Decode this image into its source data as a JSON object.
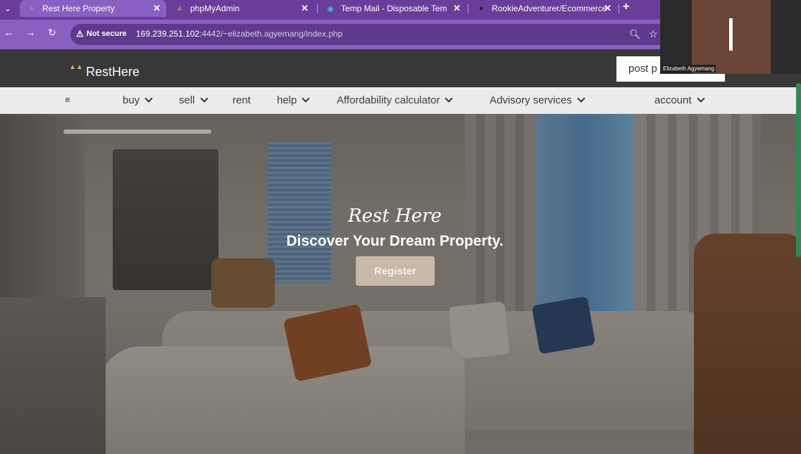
{
  "browser": {
    "tabs": [
      {
        "title": "Rest Here Property",
        "active": true,
        "icon": "globe-icon"
      },
      {
        "title": "phpMyAdmin",
        "active": false,
        "icon": "phpmyadmin-icon"
      },
      {
        "title": "Temp Mail - Disposable Tempo",
        "active": false,
        "icon": "tempmail-icon"
      },
      {
        "title": "RookieAdventurer/Ecommerce",
        "active": false,
        "icon": "github-icon"
      }
    ],
    "security_label": "Not secure",
    "url_host": "169.239.251.102",
    "url_rest": ":4442/~elizabeth.agyemang/index.php"
  },
  "header": {
    "brand": "RestHere",
    "post_button": "post p"
  },
  "nav": {
    "items": [
      {
        "label": "buy",
        "dropdown": true
      },
      {
        "label": "sell",
        "dropdown": true
      },
      {
        "label": "rent",
        "dropdown": false
      },
      {
        "label": "help",
        "dropdown": true
      },
      {
        "label": "Affordability calculator",
        "dropdown": true
      },
      {
        "label": "Advisory services",
        "dropdown": true
      },
      {
        "label": "account",
        "dropdown": true
      }
    ]
  },
  "hero": {
    "script_title": "Rest Here",
    "headline": "Discover Your Dream Property.",
    "register_button": "Register"
  },
  "video": {
    "participant_name": "Elizabeth Agyemang"
  },
  "colors": {
    "tab_strip": "#6a3d9a",
    "toolbar": "#8a5fc2",
    "site_header": "#383838",
    "navbar": "#ececec",
    "register_button": "#c8b8a8"
  }
}
